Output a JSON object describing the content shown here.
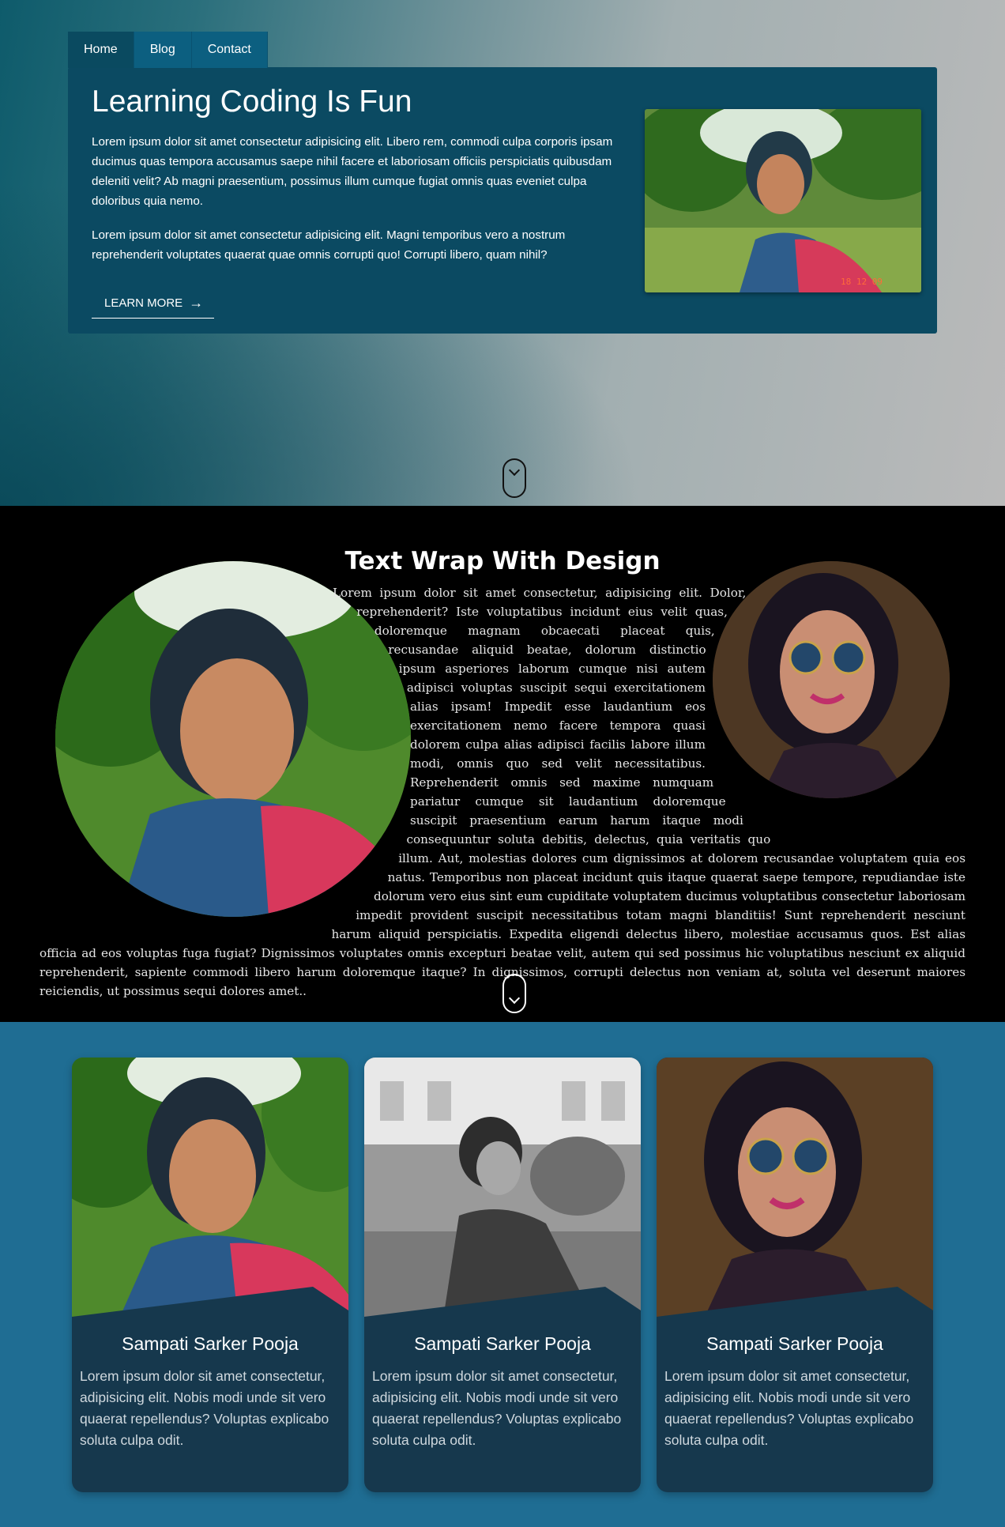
{
  "nav": {
    "tabs": [
      {
        "label": "Home",
        "active": true
      },
      {
        "label": "Blog",
        "active": false
      },
      {
        "label": "Contact",
        "active": false
      }
    ]
  },
  "hero": {
    "title": "Learning Coding Is Fun",
    "paragraph1": "Lorem ipsum dolor sit amet consectetur adipisicing elit. Libero rem, commodi culpa corporis ipsam ducimus quas tempora accusamus saepe nihil facere et laboriosam officiis perspiciatis quibusdam deleniti velit? Ab magni praesentium, possimus illum cumque fugiat omnis quas eveniet culpa doloribus quia nemo.",
    "paragraph2": "Lorem ipsum dolor sit amet consectetur adipisicing elit. Magni temporibus vero a nostrum reprehenderit voluptates quaerat quae omnis corrupti quo! Corrupti libero, quam nihil?",
    "cta_label": "LEARN MORE",
    "cta_arrow": "→",
    "image_stamp": "18 12 09"
  },
  "text_wrap": {
    "title": "Text Wrap With Design",
    "body": "Lorem ipsum dolor sit amet consectetur, adipisicing elit. Dolor, reprehenderit? Iste voluptatibus incidunt eius velit quas, doloremque magnam obcaecati placeat quis, recusandae aliquid beatae, dolorum distinctio ipsum asperiores laborum cumque nisi autem adipisci voluptas suscipit sequi exercitationem alias ipsam! Impedit esse laudantium eos exercitationem nemo facere tempora quasi dolorem culpa alias adipisci facilis labore illum modi, omnis quo sed velit necessitatibus. Reprehenderit omnis sed maxime numquam pariatur cumque sit laudantium doloremque suscipit praesentium earum harum itaque modi consequuntur soluta debitis, delectus, quia veritatis quo illum. Aut, molestias dolores cum dignissimos at dolorem recusandae voluptatem quia eos natus. Temporibus non placeat incidunt quis itaque quaerat saepe tempore, repudiandae iste dolorum vero eius sint eum cupiditate voluptatem ducimus voluptatibus consectetur laboriosam impedit provident suscipit necessitatibus totam magni blanditiis! Sunt reprehenderit nesciunt harum aliquid perspiciatis. Expedita eligendi delectus libero, molestiae accusamus quos. Est alias officia ad eos voluptas fuga fugiat? Dignissimos voluptates omnis excepturi beatae velit, autem qui sed possimus hic voluptatibus nesciunt ex aliquid reprehenderit, sapiente commodi libero harum doloremque itaque? In dignissimos, corrupti delectus non veniam at, soluta vel deserunt maiores reiciendis, ut possimus sequi dolores amet.."
  },
  "profiles": [
    {
      "name": "Sampati Sarker Pooja",
      "desc": "Lorem ipsum dolor sit amet consectetur, adipisicing elit. Nobis modi unde sit vero quaerat repellendus? Voluptas explicabo soluta culpa odit."
    },
    {
      "name": "Sampati Sarker Pooja",
      "desc": "Lorem ipsum dolor sit amet consectetur, adipisicing elit. Nobis modi unde sit vero quaerat repellendus? Voluptas explicabo soluta culpa odit."
    },
    {
      "name": "Sampati Sarker Pooja",
      "desc": "Lorem ipsum dolor sit amet consectetur, adipisicing elit. Nobis modi unde sit vero quaerat repellendus? Voluptas explicabo soluta culpa odit."
    }
  ],
  "icons": {
    "scroll_up": "mouse-scroll-icon",
    "scroll_down": "mouse-scroll-icon"
  }
}
